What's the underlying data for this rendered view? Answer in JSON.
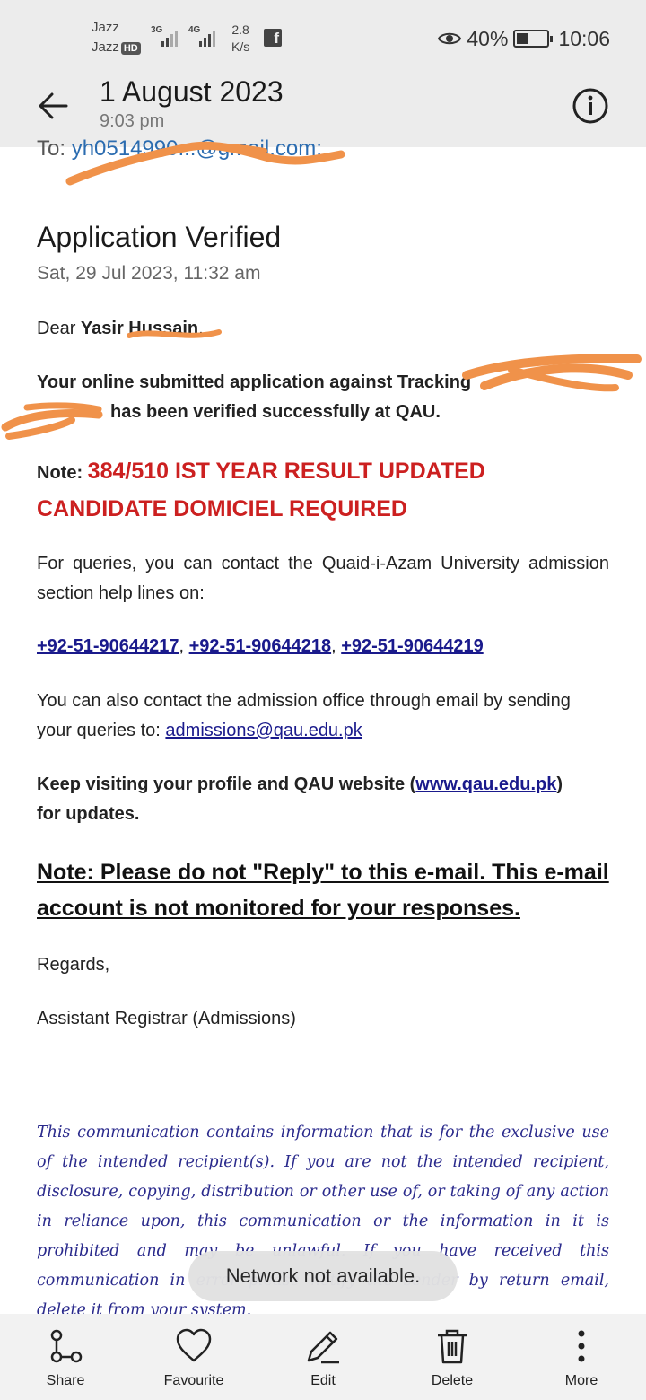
{
  "status_bar": {
    "carrier1": "Jazz",
    "carrier2": "Jazz",
    "hd_badge": "HD",
    "net1": "3G",
    "net2": "4G",
    "speed_value": "2.8",
    "speed_unit": "K/s",
    "battery": "40%",
    "battery_level": 0.4,
    "time": "10:06"
  },
  "header": {
    "title": "1 August 2023",
    "subtitle": "9:03 pm"
  },
  "email": {
    "to_label": "To:",
    "to_address": "yh0514990...@gmail.com;",
    "subject": "Application Verified",
    "sent_date": "Sat, 29 Jul 2023, 11:32 am",
    "greeting_prefix": "Dear",
    "greeting_name": "Yasir Hussain",
    "greeting_suffix": ",",
    "verified_line1": "Your online submitted application against Tracking",
    "verified_line2": "has been verified successfully at QAU.",
    "note_label": "Note:",
    "note_text1": "384/510 IST YEAR RESULT UPDATED",
    "note_text2": "CANDIDATE DOMICIEL REQUIRED",
    "queries_text": "For queries, you can contact the Quaid-i-Azam University admission section help lines on:",
    "phones": [
      "+92-51-90644217",
      "+92-51-90644218",
      "+92-51-90644219"
    ],
    "phone_sep": ", ",
    "email_contact_text": "You can also contact the admission office through email by sending your queries to:",
    "admissions_email": "admissions@qau.edu.pk",
    "keep_visiting_prefix": "Keep visiting your profile and QAU website (",
    "website": "www.qau.edu.pk",
    "keep_visiting_suffix": ")",
    "keep_visiting_end": "for updates.",
    "no_reply_note": "Note: Please do not \"Reply\" to this e-mail. This e-mail account is not monitored for your responses.",
    "regards": "Regards,",
    "signature": "Assistant Registrar (Admissions)",
    "disclaimer": "This communication contains information that is for the exclusive use of the intended recipient(s). If you are not the intended recipient, disclosure, copying, distribution or other use of, or taking of any action in reliance upon, this communication or the information in it is prohibited and may be unlawful. If you have received this communication in error please notify the sender by return email, delete it from your system."
  },
  "toast": "Network not available.",
  "bottom_bar": {
    "share": "Share",
    "favourite": "Favourite",
    "edit": "Edit",
    "delete": "Delete",
    "more": "More"
  }
}
